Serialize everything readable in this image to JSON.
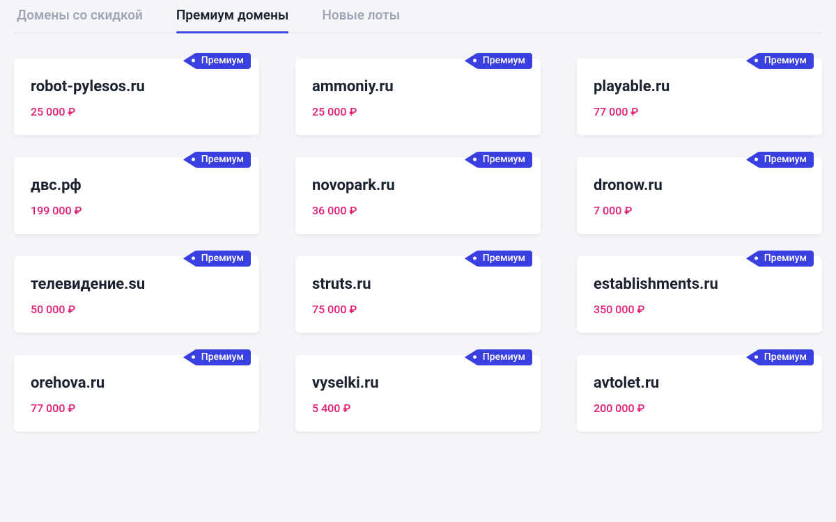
{
  "tabs": [
    {
      "label": "Домены со скидкой",
      "active": false
    },
    {
      "label": "Премиум домены",
      "active": true
    },
    {
      "label": "Новые лоты",
      "active": false
    }
  ],
  "badge_label": "Премиум",
  "domains": [
    {
      "name": "robot-pylesos.ru",
      "price": "25 000 ₽"
    },
    {
      "name": "ammoniy.ru",
      "price": "25 000 ₽"
    },
    {
      "name": "playable.ru",
      "price": "77 000 ₽"
    },
    {
      "name": "двс.рф",
      "price": "199 000 ₽"
    },
    {
      "name": "novopark.ru",
      "price": "36 000 ₽"
    },
    {
      "name": "dronow.ru",
      "price": "7 000 ₽"
    },
    {
      "name": "телевидение.su",
      "price": "50 000 ₽"
    },
    {
      "name": "struts.ru",
      "price": "75 000 ₽"
    },
    {
      "name": "establishments.ru",
      "price": "350 000 ₽"
    },
    {
      "name": "orehova.ru",
      "price": "77 000 ₽"
    },
    {
      "name": "vyselki.ru",
      "price": "5 400 ₽"
    },
    {
      "name": "avtolet.ru",
      "price": "200 000 ₽"
    }
  ]
}
